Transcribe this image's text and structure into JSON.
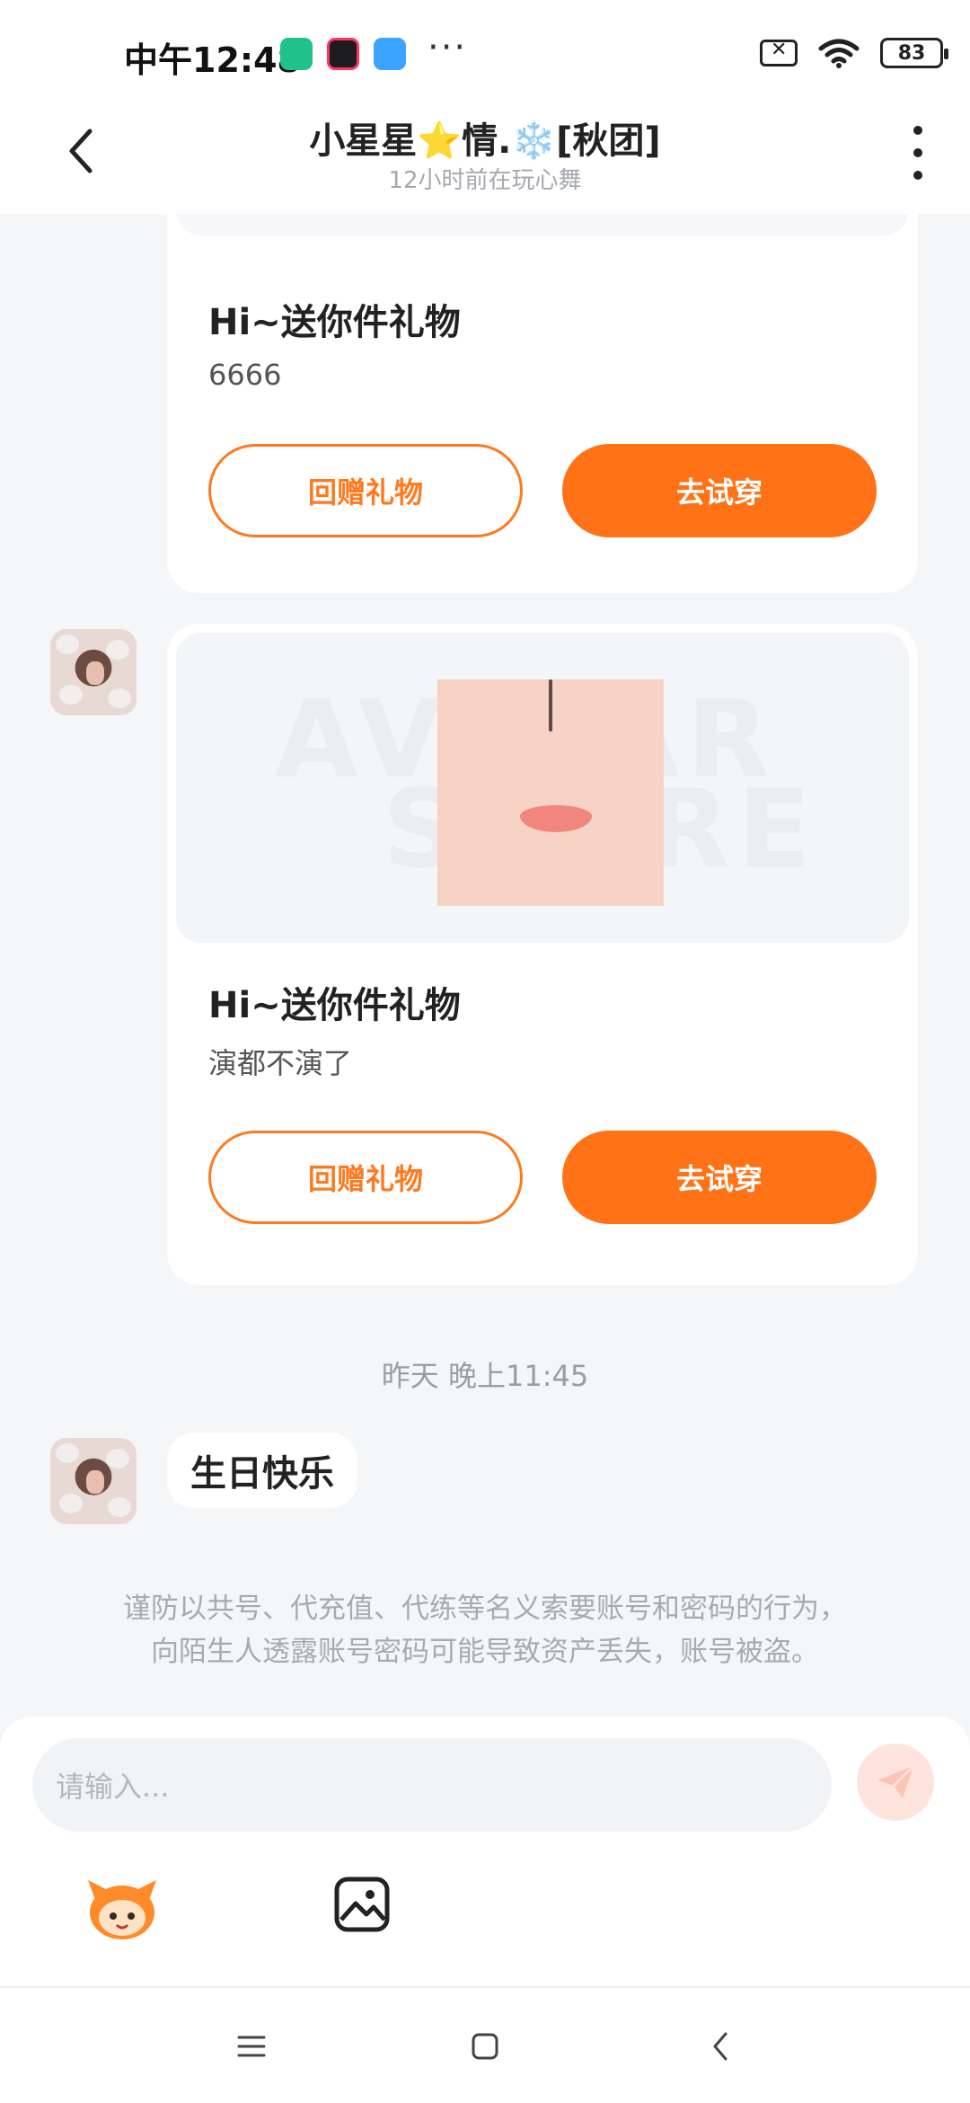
{
  "status_bar": {
    "time": "中午12:48",
    "dots": "···",
    "battery": "83"
  },
  "header": {
    "title": "小星星⭐情.❄️[秋团]",
    "subtitle": "12小时前在玩心舞"
  },
  "messages": {
    "gift1": {
      "title": "Hi~送你件礼物",
      "note": "6666",
      "return_label": "回赠礼物",
      "try_label": "去试穿"
    },
    "gift2": {
      "title": "Hi~送你件礼物",
      "note": "演都不演了",
      "return_label": "回赠礼物",
      "try_label": "去试穿",
      "watermark_line1": "AVATAR",
      "watermark_line2": "STORE"
    },
    "timestamp": "昨天 晚上11:45",
    "text_message": "生日快乐"
  },
  "warning": {
    "line1": "谨防以共号、代充值、代练等名义索要账号和密码的行为，",
    "line2": "向陌生人透露账号密码可能导致资产丢失，账号被盗。"
  },
  "input": {
    "placeholder": "请输入..."
  },
  "colors": {
    "accent": "#ff7316",
    "background": "#f5f6f8"
  },
  "icons": [
    "back-icon",
    "more-icon",
    "send-icon",
    "emoji-mascot-icon",
    "image-icon",
    "menu-icon",
    "home-icon",
    "nav-back-icon"
  ]
}
